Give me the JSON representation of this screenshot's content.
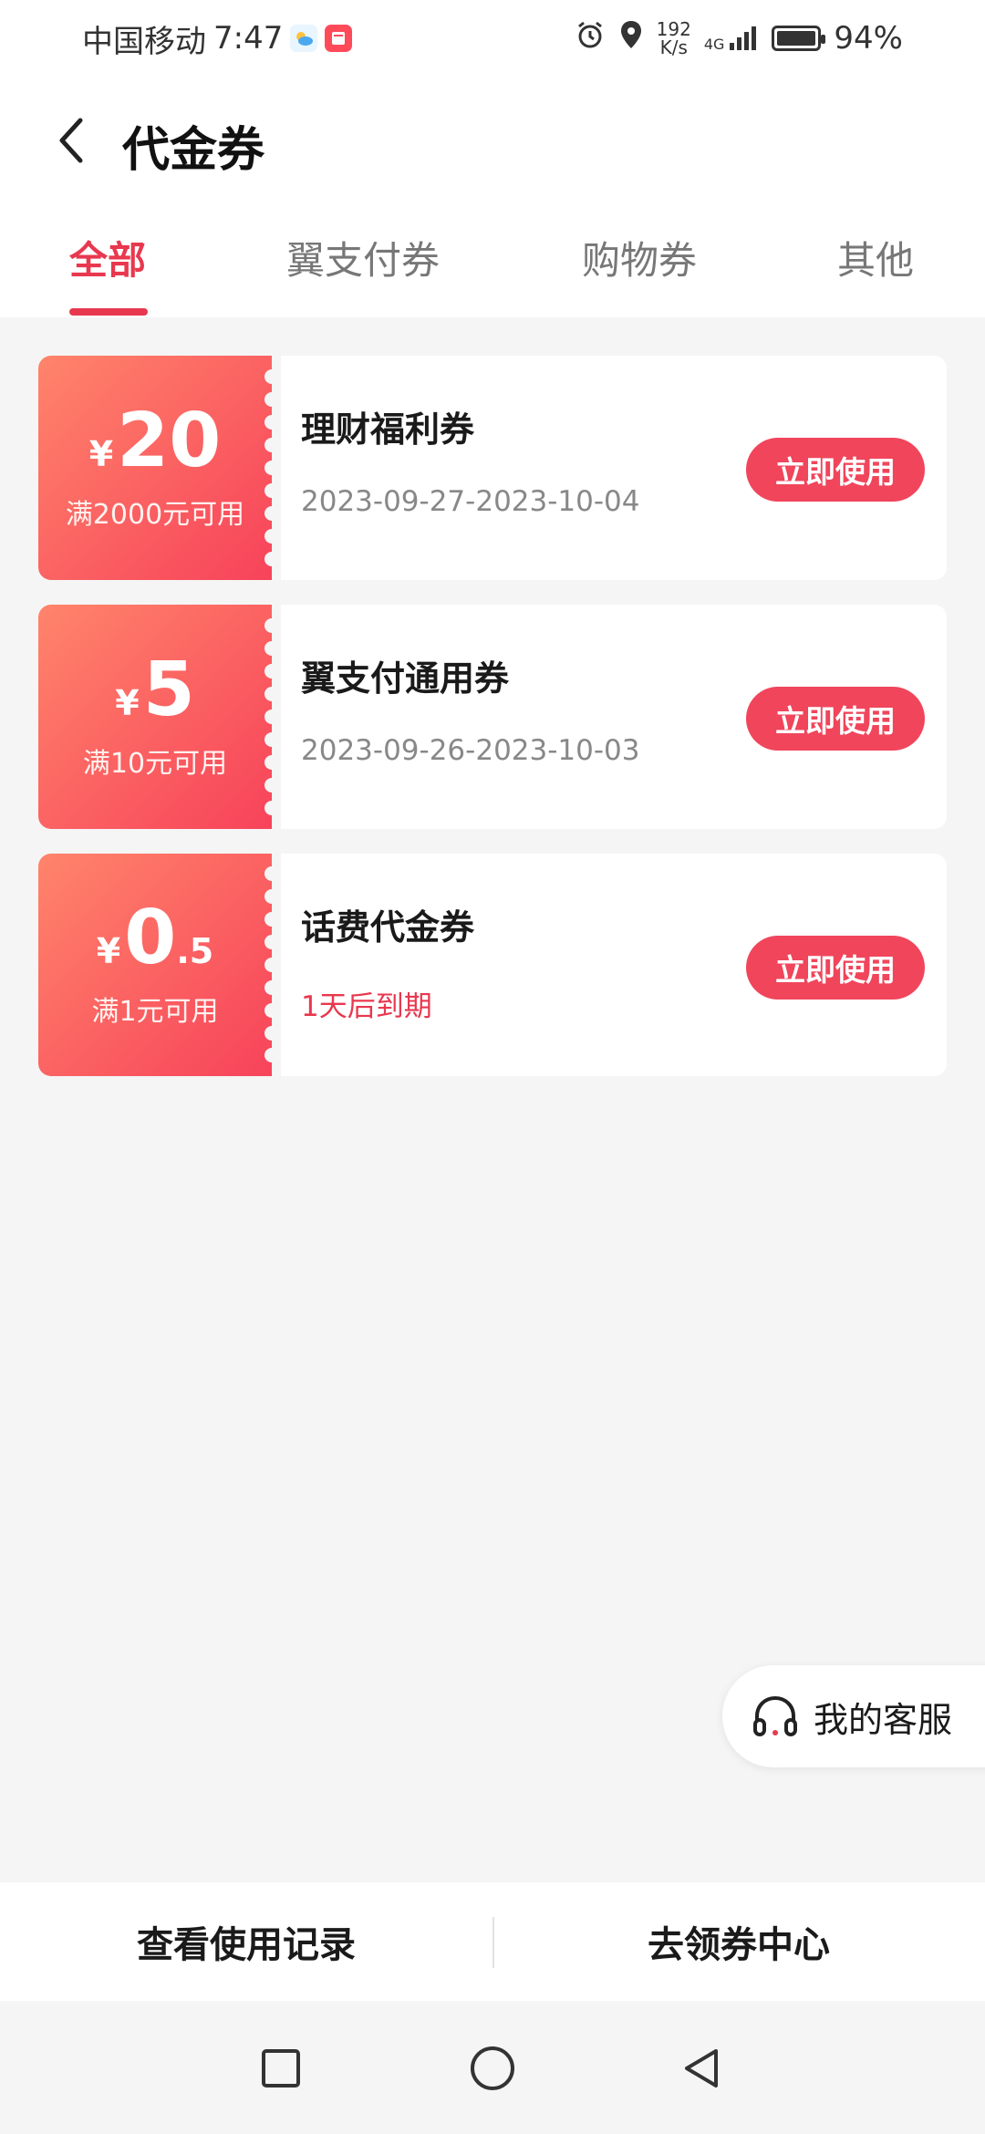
{
  "status_bar": {
    "carrier": "中国移动",
    "time": "7:47",
    "net_speed_value": "192",
    "net_speed_unit": "K/s",
    "network_type": "4G",
    "battery": "94%"
  },
  "header": {
    "title": "代金券",
    "back_icon": "chevron-left-icon"
  },
  "tabs": [
    {
      "label": "全部",
      "active": true
    },
    {
      "label": "翼支付券",
      "active": false
    },
    {
      "label": "购物券",
      "active": false
    },
    {
      "label": "其他",
      "active": false
    }
  ],
  "coupons": [
    {
      "currency": "¥",
      "amount": "20",
      "amount_decimal": "",
      "condition": "满2000元可用",
      "name": "理财福利券",
      "date": "2023-09-27-2023-10-04",
      "button": "立即使用"
    },
    {
      "currency": "¥",
      "amount": "5",
      "amount_decimal": "",
      "condition": "满10元可用",
      "name": "翼支付通用券",
      "date": "2023-09-26-2023-10-03",
      "button": "立即使用"
    },
    {
      "currency": "¥",
      "amount": "0",
      "amount_decimal": ".5",
      "condition": "满1元可用",
      "name": "话费代金券",
      "date": "1天后到期",
      "button": "立即使用"
    }
  ],
  "service": {
    "label": "我的客服",
    "icon": "headset-icon"
  },
  "bottom_bar": {
    "history": "查看使用记录",
    "center": "去领券中心"
  },
  "colors": {
    "accent": "#e8384f",
    "coupon_gradient_start": "#ff846b",
    "coupon_gradient_end": "#f7435a"
  }
}
